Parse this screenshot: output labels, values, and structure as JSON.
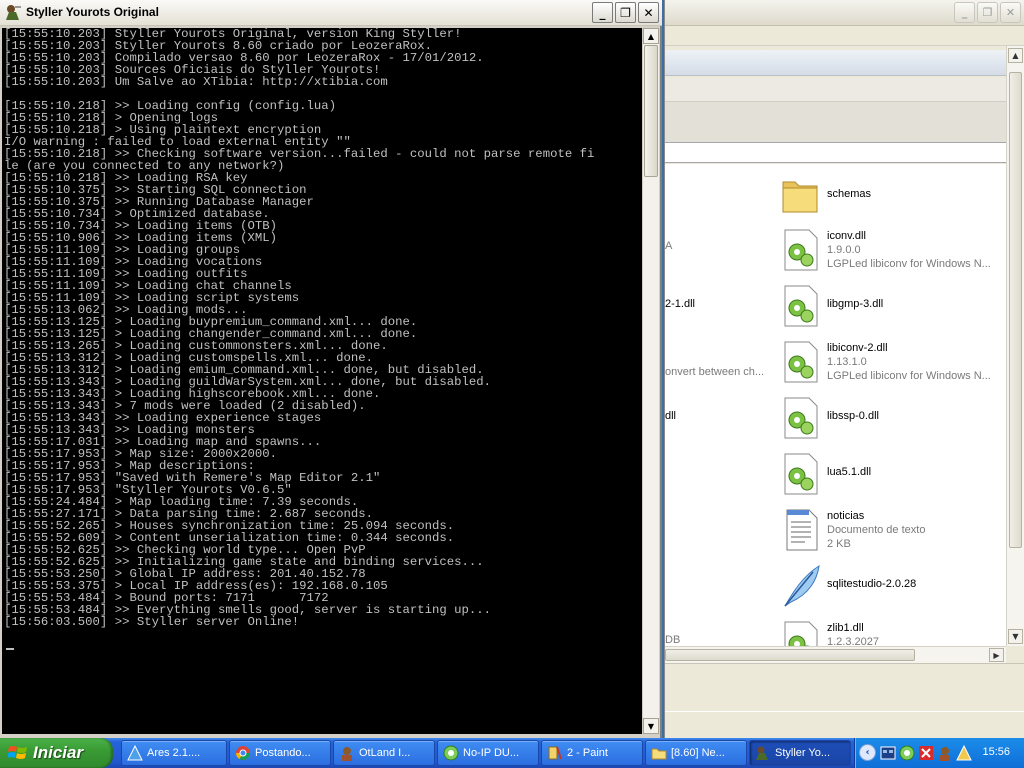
{
  "console": {
    "title": "Styller Yourots Original",
    "buttons": {
      "minimize": "_",
      "restore": "❐",
      "close": "✕"
    },
    "lines": [
      "[15:55:10.203] Styller Yourots Original, version King Styller!",
      "[15:55:10.203] Styller Yourots 8.60 criado por LeozeraRox.",
      "[15:55:10.203] Compilado versao 8.60 por LeozeraRox - 17/01/2012.",
      "[15:55:10.203] Sources Oficiais do Styller Yourots!",
      "[15:55:10.203] Um Salve ao XTibia: http://xtibia.com",
      "",
      "[15:55:10.218] >> Loading config (config.lua)",
      "[15:55:10.218] > Opening logs",
      "[15:55:10.218] > Using plaintext encryption",
      "I/O warning : failed to load external entity \"\"",
      "[15:55:10.218] >> Checking software version...failed - could not parse remote fi",
      "le (are you connected to any network?)",
      "[15:55:10.218] >> Loading RSA key",
      "[15:55:10.375] >> Starting SQL connection",
      "[15:55:10.375] >> Running Database Manager",
      "[15:55:10.734] > Optimized database.",
      "[15:55:10.734] >> Loading items (OTB)",
      "[15:55:10.906] >> Loading items (XML)",
      "[15:55:11.109] >> Loading groups",
      "[15:55:11.109] >> Loading vocations",
      "[15:55:11.109] >> Loading outfits",
      "[15:55:11.109] >> Loading chat channels",
      "[15:55:11.109] >> Loading script systems",
      "[15:55:13.062] >> Loading mods...",
      "[15:55:13.125] > Loading buypremium_command.xml... done.",
      "[15:55:13.125] > Loading changender_command.xml... done.",
      "[15:55:13.265] > Loading custommonsters.xml... done.",
      "[15:55:13.312] > Loading customspells.xml... done.",
      "[15:55:13.312] > Loading emium_command.xml... done, but disabled.",
      "[15:55:13.343] > Loading guildWarSystem.xml... done, but disabled.",
      "[15:55:13.343] > Loading highscorebook.xml... done.",
      "[15:55:13.343] > 7 mods were loaded (2 disabled).",
      "[15:55:13.343] >> Loading experience stages",
      "[15:55:13.343] >> Loading monsters",
      "[15:55:17.031] >> Loading map and spawns...",
      "[15:55:17.953] > Map size: 2000x2000.",
      "[15:55:17.953] > Map descriptions:",
      "[15:55:17.953] \"Saved with Remere's Map Editor 2.1\"",
      "[15:55:17.953] \"Styller Yourots V0.6.5\"",
      "[15:55:24.484] > Map loading time: 7.39 seconds.",
      "[15:55:27.171] > Data parsing time: 2.687 seconds.",
      "[15:55:52.265] > Houses synchronization time: 25.094 seconds.",
      "[15:55:52.609] > Content unserialization time: 0.344 seconds.",
      "[15:55:52.625] >> Checking world type... Open PvP",
      "[15:55:52.625] >> Initializing game state and binding services...",
      "[15:55:53.250] > Global IP address: 201.40.152.78",
      "[15:55:53.375] > Local IP address(es): 192.168.0.105",
      "[15:55:53.484] > Bound ports: 7171      7172",
      "[15:55:53.484] >> Everything smells good, server is starting up...",
      "[15:56:03.500] >> Styller server Online!"
    ]
  },
  "explorer": {
    "buttons": {
      "minimize": "_",
      "restore": "❐",
      "close": "✕"
    },
    "files": [
      {
        "name": "schemas",
        "sub1": "",
        "sub2": "",
        "icon": "folder-icon"
      },
      {
        "name": "iconv.dll",
        "sub1": "1.9.0.0",
        "sub2": "LGPLed libiconv for Windows N...",
        "icon": "dll-icon"
      },
      {
        "name": "libgmp-3.dll",
        "sub1": "",
        "sub2": "",
        "icon": "dll-icon"
      },
      {
        "name": "libiconv-2.dll",
        "sub1": "1.13.1.0",
        "sub2": "LGPLed libiconv for Windows N...",
        "icon": "dll-icon"
      },
      {
        "name": "libssp-0.dll",
        "sub1": "",
        "sub2": "",
        "icon": "dll-icon"
      },
      {
        "name": "lua5.1.dll",
        "sub1": "",
        "sub2": "",
        "icon": "dll-icon"
      },
      {
        "name": "noticias",
        "sub1": "Documento de texto",
        "sub2": "2 KB",
        "icon": "text-document-icon"
      },
      {
        "name": "sqlitestudio-2.0.28",
        "sub1": "",
        "sub2": "",
        "icon": "feather-icon"
      },
      {
        "name": "zlib1.dll",
        "sub1": "1.2.3.2027",
        "sub2": "",
        "icon": "dll-icon"
      }
    ],
    "partials": [
      "A",
      "2-1.dll",
      "onvert between ch...",
      "dll",
      "DB"
    ]
  },
  "taskbar": {
    "start_label": "Iniciar",
    "tasks": [
      {
        "label": "Ares 2.1....",
        "icon": "ares-icon",
        "active": false
      },
      {
        "label": "Postando...",
        "icon": "chrome-icon",
        "active": false
      },
      {
        "label": "OtLand I...",
        "icon": "otland-icon",
        "active": false
      },
      {
        "label": "No-IP DU...",
        "icon": "noip-icon",
        "active": false
      },
      {
        "label": "2 - Paint",
        "icon": "paint-icon",
        "active": false
      },
      {
        "label": "[8.60] Ne...",
        "icon": "folder-icon",
        "active": false
      },
      {
        "label": "Styller Yo...",
        "icon": "styller-icon",
        "active": true
      }
    ],
    "tray": {
      "expand": "‹",
      "clock": "15:56"
    }
  },
  "colors": {
    "console_bg": "#000000",
    "console_text": "#c0c0c0",
    "taskbar_blue": "#2258d0",
    "start_green": "#3a9c35"
  }
}
